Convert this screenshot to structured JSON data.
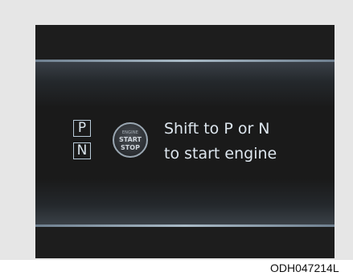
{
  "gears": {
    "p": "P",
    "n": "N"
  },
  "engine_button": {
    "engine": "ENGINE",
    "start": "START",
    "stop": "STOP"
  },
  "message": {
    "line1": "Shift to P or N",
    "line2": "to start engine"
  },
  "image_code": "ODH047214L"
}
